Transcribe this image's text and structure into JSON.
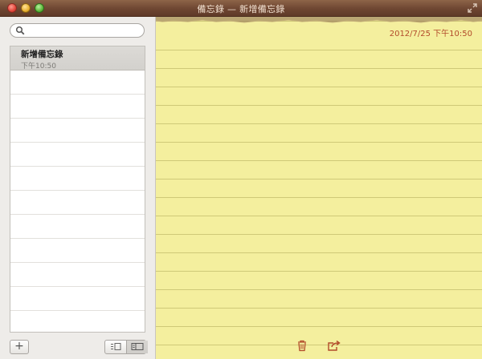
{
  "window": {
    "title": "備忘錄 — 新增備忘錄"
  },
  "search": {
    "placeholder": "",
    "value": ""
  },
  "notes": [
    {
      "title": "新增備忘錄",
      "time": "下午10:50"
    }
  ],
  "toolbar": {
    "add_label": "+"
  },
  "editor": {
    "date": "2012/7/25 下午10:50",
    "body": ""
  },
  "icons": {
    "search": "search-icon",
    "trash": "trash-icon",
    "share": "share-icon",
    "list_view": "list-view-icon",
    "note_view": "note-view-icon"
  },
  "colors": {
    "titlebar": "#6e4632",
    "paper": "#f4ef9e",
    "accent": "#b24a2a"
  }
}
